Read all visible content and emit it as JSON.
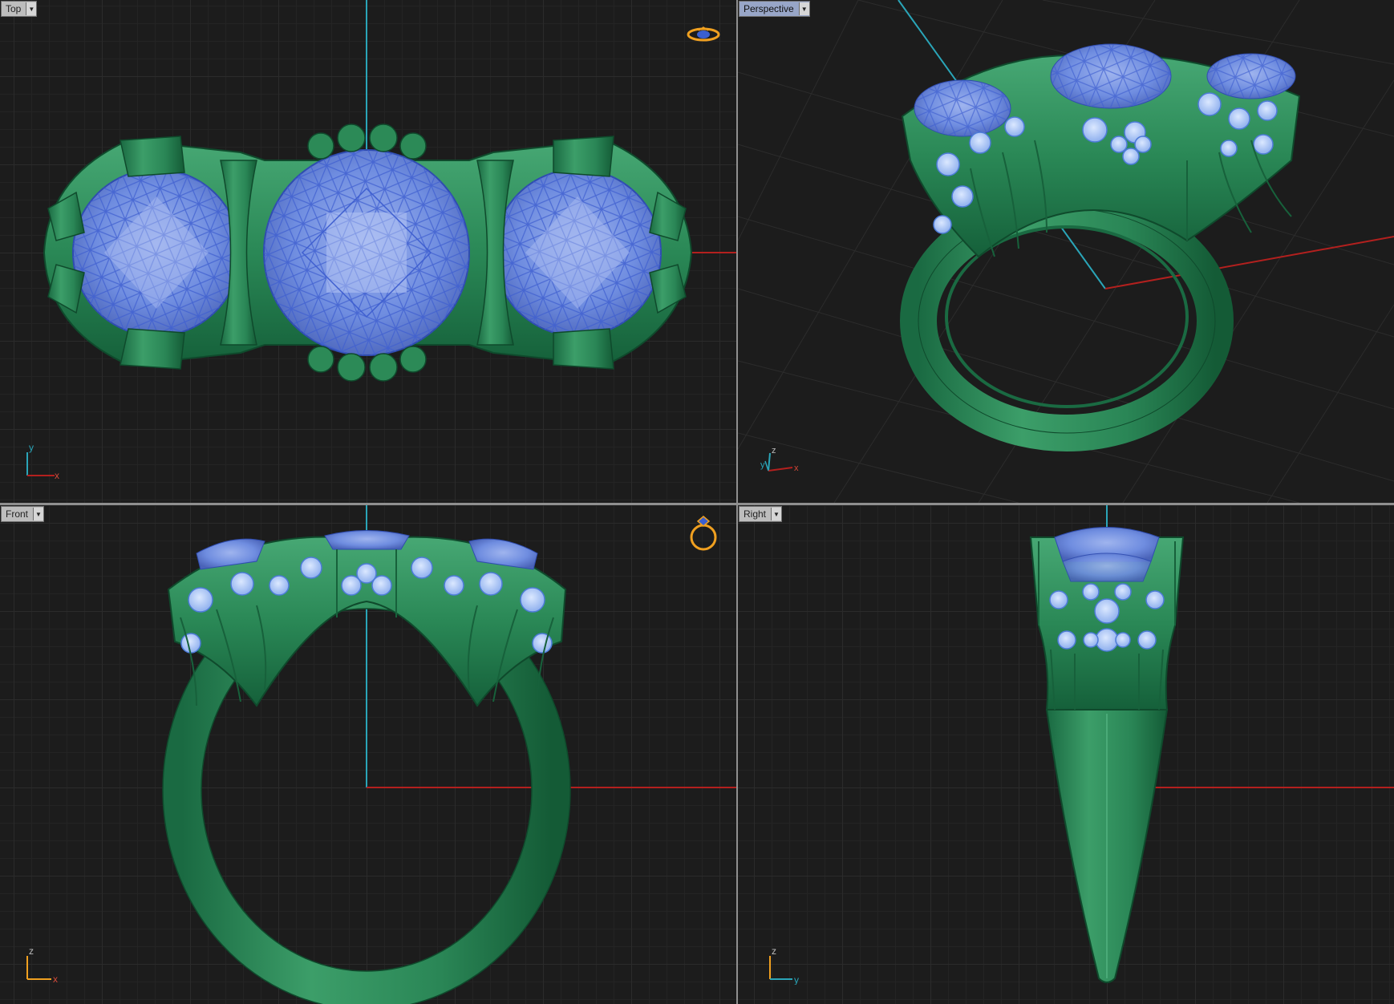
{
  "viewports": {
    "top": {
      "label": "Top",
      "axis_a": "y",
      "axis_b": "x"
    },
    "perspective": {
      "label": "Perspective",
      "axis_a": "z",
      "axis_b": "x",
      "axis_c": "y"
    },
    "front": {
      "label": "Front",
      "axis_a": "z",
      "axis_b": "x"
    },
    "right": {
      "label": "Right",
      "axis_a": "z",
      "axis_b": "y"
    }
  },
  "colors": {
    "metal": "#2c8a57",
    "gem": "#6c8ce2",
    "small_gem": "#a8c4f2",
    "axis_red": "#b3201e",
    "axis_teal": "#2aa5b8",
    "active_tab": "#98a6c8"
  },
  "icons": {
    "top_corner": "ring-top-view-icon",
    "front_corner": "ring-icon"
  }
}
